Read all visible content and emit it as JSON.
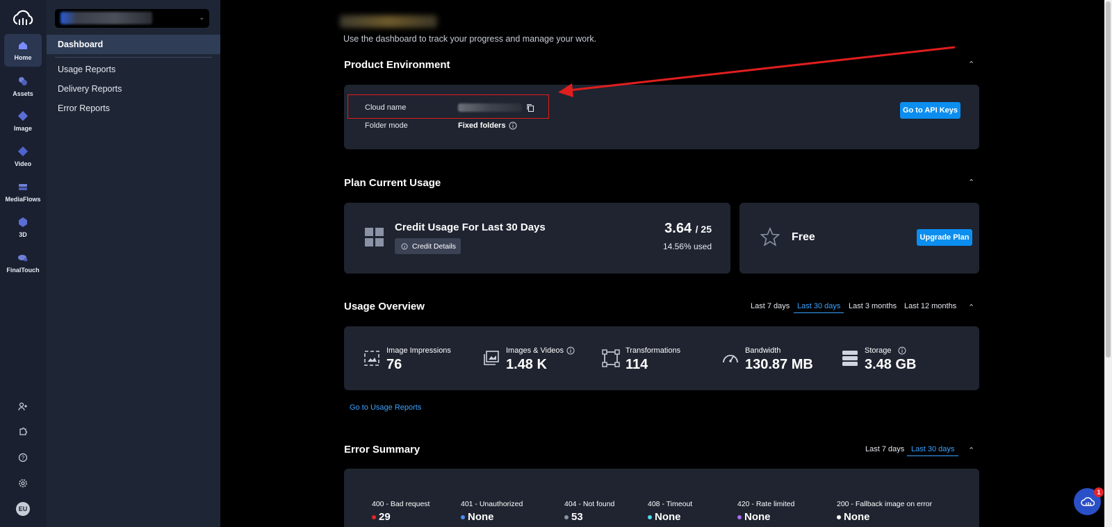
{
  "rail": {
    "items": [
      {
        "label": "Home",
        "icon": "home-icon"
      },
      {
        "label": "Assets",
        "icon": "assets-icon"
      },
      {
        "label": "Image",
        "icon": "image-icon"
      },
      {
        "label": "Video",
        "icon": "video-icon"
      },
      {
        "label": "MediaFlows",
        "icon": "mediaflows-icon"
      },
      {
        "label": "3D",
        "icon": "cube-icon"
      },
      {
        "label": "FinalTouch",
        "icon": "finaltouch-icon"
      }
    ],
    "avatar": "EU"
  },
  "sidebar": {
    "active": "Dashboard",
    "links": [
      "Usage Reports",
      "Delivery Reports",
      "Error Reports"
    ]
  },
  "header": {
    "subtitle": "Use the dashboard to track your progress and manage your work."
  },
  "product_env": {
    "title": "Product Environment",
    "cloud_name_label": "Cloud name",
    "folder_mode_label": "Folder mode",
    "folder_mode_value": "Fixed folders",
    "api_button": "Go to API Keys"
  },
  "plan": {
    "title": "Plan Current Usage",
    "credit_title": "Credit Usage For Last 30 Days",
    "credit_details": "Credit Details",
    "used": "3.64",
    "total": "/ 25",
    "percent": "14.56% used",
    "plan_name": "Free",
    "upgrade": "Upgrade Plan"
  },
  "usage": {
    "title": "Usage Overview",
    "ranges": [
      "Last 7 days",
      "Last 30 days",
      "Last 3 months",
      "Last 12 months"
    ],
    "selected_range": "Last 30 days",
    "metrics": [
      {
        "label": "Image Impressions",
        "value": "76"
      },
      {
        "label": "Images & Videos",
        "value": "1.48 K"
      },
      {
        "label": "Transformations",
        "value": "114"
      },
      {
        "label": "Bandwidth",
        "value": "130.87 MB"
      },
      {
        "label": "Storage",
        "value": "3.48 GB"
      }
    ],
    "link": "Go to Usage Reports"
  },
  "errors": {
    "title": "Error Summary",
    "ranges": [
      "Last 7 days",
      "Last 30 days"
    ],
    "selected_range": "Last 30 days",
    "items": [
      {
        "label": "400 - Bad request",
        "value": "29",
        "color": "#e5242b"
      },
      {
        "label": "401 - Unauthorized",
        "value": "None",
        "color": "#4a8cf7"
      },
      {
        "label": "404 - Not found",
        "value": "53",
        "color": "#8a93a6"
      },
      {
        "label": "408 - Timeout",
        "value": "None",
        "color": "#4fd9e6"
      },
      {
        "label": "420 - Rate limited",
        "value": "None",
        "color": "#a66cf2"
      },
      {
        "label": "200 - Fallback image on error",
        "value": "None",
        "color": "#ffffff"
      }
    ]
  },
  "chat": {
    "badge": "1"
  },
  "colors": {
    "accent": "#0c8ef0",
    "annotation": "#e01e1e"
  }
}
